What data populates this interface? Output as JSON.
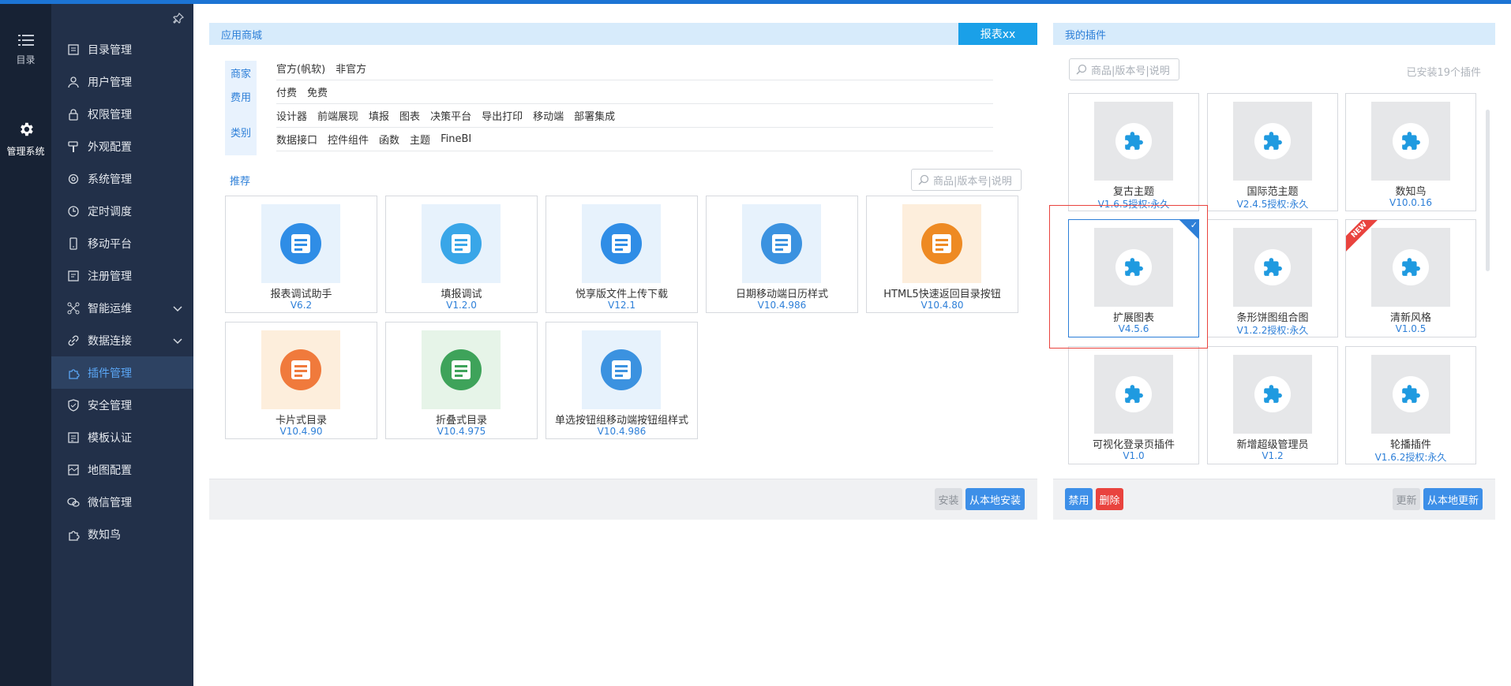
{
  "rail": {
    "catalog_label": "目录",
    "system_label": "管理系统"
  },
  "menu": [
    {
      "label": "目录管理",
      "icon": "catalog-icon"
    },
    {
      "label": "用户管理",
      "icon": "user-icon"
    },
    {
      "label": "权限管理",
      "icon": "lock-icon"
    },
    {
      "label": "外观配置",
      "icon": "brush-icon"
    },
    {
      "label": "系统管理",
      "icon": "gear-icon"
    },
    {
      "label": "定时调度",
      "icon": "clock-icon"
    },
    {
      "label": "移动平台",
      "icon": "mobile-icon"
    },
    {
      "label": "注册管理",
      "icon": "register-icon"
    },
    {
      "label": "智能运维",
      "icon": "ops-icon"
    },
    {
      "label": "数据连接",
      "icon": "link-icon"
    },
    {
      "label": "插件管理",
      "icon": "plugin-icon"
    },
    {
      "label": "安全管理",
      "icon": "shield-icon"
    },
    {
      "label": "模板认证",
      "icon": "template-icon"
    },
    {
      "label": "地图配置",
      "icon": "map-icon"
    },
    {
      "label": "微信管理",
      "icon": "wechat-icon"
    },
    {
      "label": "数知鸟",
      "icon": "bird-icon"
    }
  ],
  "store": {
    "title": "应用商城",
    "tab": "报表xx",
    "filters": {
      "vendor_label": "商家",
      "fee_label": "费用",
      "category_label": "类别",
      "vendor": [
        "官方(帆软)",
        "非官方"
      ],
      "fee": [
        "付费",
        "免费"
      ],
      "category_row1": [
        "设计器",
        "前端展现",
        "填报",
        "图表",
        "决策平台",
        "导出打印",
        "移动端",
        "部署集成"
      ],
      "category_row2": [
        "数据接口",
        "控件组件",
        "函数",
        "主题",
        "FineBI"
      ]
    },
    "recommend_label": "推荐",
    "search_placeholder": "商品|版本号|说明",
    "cards": [
      {
        "name": "报表调试助手",
        "version": "V6.2"
      },
      {
        "name": "填报调试",
        "version": "V1.2.0"
      },
      {
        "name": "悦享版文件上传下载",
        "version": "V12.1"
      },
      {
        "name": "日期移动端日历样式",
        "version": "V10.4.986"
      },
      {
        "name": "HTML5快速返回目录按钮",
        "version": "V10.4.80"
      },
      {
        "name": "卡片式目录",
        "version": "V10.4.90"
      },
      {
        "name": "折叠式目录",
        "version": "V10.4.975"
      },
      {
        "name": "单选按钮组移动端按钮组样式",
        "version": "V10.4.986"
      }
    ],
    "install_label": "安装",
    "local_install_label": "从本地安装"
  },
  "mine": {
    "title": "我的插件",
    "search_placeholder": "商品|版本号|说明",
    "count": "已安装19个插件",
    "plugins": [
      {
        "name": "复古主题",
        "version": "V1.6.5授权:永久"
      },
      {
        "name": "国际范主题",
        "version": "V2.4.5授权:永久"
      },
      {
        "name": "数知鸟",
        "version": "V10.0.16"
      },
      {
        "name": "扩展图表",
        "version": "V4.5.6"
      },
      {
        "name": "条形饼图组合图",
        "version": "V1.2.2授权:永久"
      },
      {
        "name": "清新风格",
        "version": "V1.0.5"
      },
      {
        "name": "可视化登录页插件",
        "version": "V1.0"
      },
      {
        "name": "新增超级管理员",
        "version": "V1.2"
      },
      {
        "name": "轮播插件",
        "version": "V1.6.2授权:永久"
      }
    ],
    "new_badge": "NEW",
    "disable_label": "禁用",
    "delete_label": "删除",
    "update_label": "更新",
    "local_update_label": "从本地更新"
  }
}
